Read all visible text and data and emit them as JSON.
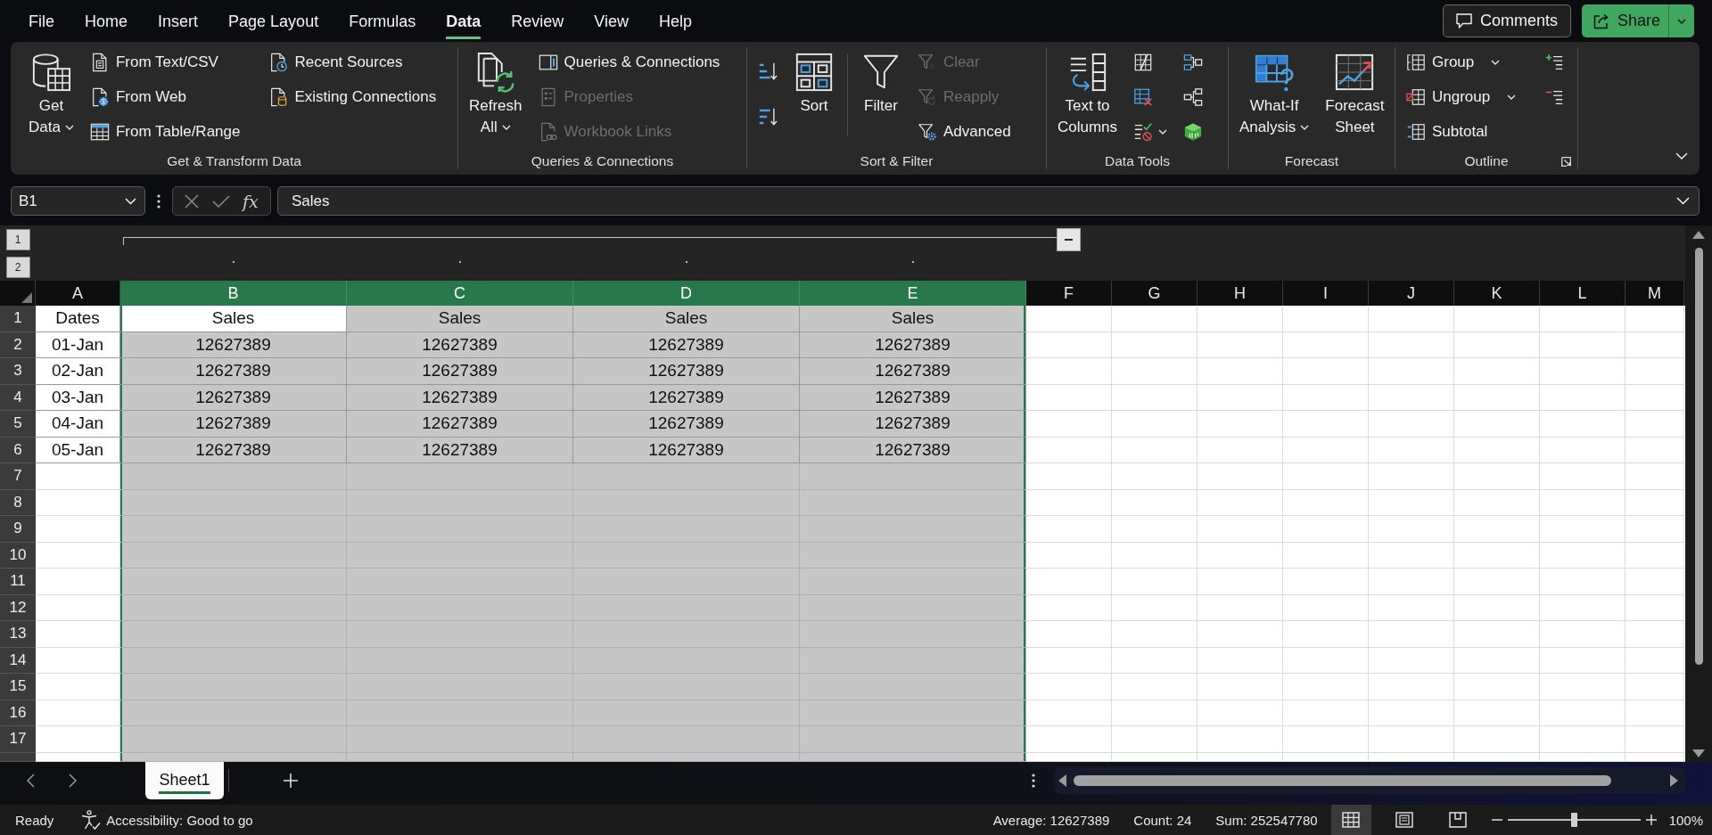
{
  "menu": {
    "tabs": [
      {
        "label": "File",
        "selected": false
      },
      {
        "label": "Home",
        "selected": false
      },
      {
        "label": "Insert",
        "selected": false
      },
      {
        "label": "Page Layout",
        "selected": false
      },
      {
        "label": "Formulas",
        "selected": false
      },
      {
        "label": "Data",
        "selected": true
      },
      {
        "label": "Review",
        "selected": false
      },
      {
        "label": "View",
        "selected": false
      },
      {
        "label": "Help",
        "selected": false
      }
    ]
  },
  "actions": {
    "comments": "Comments",
    "share": "Share"
  },
  "ribbon": {
    "groups": [
      {
        "label": "Get & Transform Data",
        "dialog_launcher": false,
        "controls": [
          {
            "kind": "large",
            "lines": [
              "Get",
              "Data"
            ],
            "dropdown": true
          },
          {
            "kind": "stack",
            "buttons": [
              {
                "label": "From Text/CSV",
                "disabled": false,
                "dropdown": false
              },
              {
                "label": "From Web",
                "disabled": false,
                "dropdown": false
              },
              {
                "label": "From Table/Range",
                "disabled": false,
                "dropdown": false
              }
            ]
          },
          {
            "kind": "stack",
            "buttons": [
              {
                "label": "Recent Sources",
                "disabled": false,
                "dropdown": false
              },
              {
                "label": "Existing Connections",
                "disabled": false,
                "dropdown": false
              }
            ]
          }
        ]
      },
      {
        "label": "Queries & Connections",
        "dialog_launcher": false,
        "controls": [
          {
            "kind": "large",
            "lines": [
              "Refresh",
              "All"
            ],
            "dropdown": true
          },
          {
            "kind": "stack",
            "buttons": [
              {
                "label": "Queries & Connections",
                "disabled": false,
                "dropdown": false
              },
              {
                "label": "Properties",
                "disabled": true,
                "dropdown": false
              },
              {
                "label": "Workbook Links",
                "disabled": true,
                "dropdown": false
              }
            ]
          }
        ]
      },
      {
        "label": "Sort & Filter",
        "dialog_launcher": false,
        "controls": [
          {
            "kind": "icons",
            "buttons": [
              {
                "disabled": false,
                "dropdown": false
              },
              {
                "disabled": false,
                "dropdown": false
              }
            ]
          },
          {
            "kind": "large",
            "lines": [
              "Sort"
            ],
            "dropdown": false
          },
          {
            "kind": "separator"
          },
          {
            "kind": "large",
            "lines": [
              "Filter"
            ],
            "dropdown": false
          },
          {
            "kind": "stack",
            "buttons": [
              {
                "label": "Clear",
                "disabled": true,
                "dropdown": false
              },
              {
                "label": "Reapply",
                "disabled": true,
                "dropdown": false
              },
              {
                "label": "Advanced",
                "disabled": false,
                "dropdown": false
              }
            ]
          }
        ]
      },
      {
        "label": "Data Tools",
        "dialog_launcher": false,
        "controls": [
          {
            "kind": "large",
            "lines": [
              "Text to",
              "Columns"
            ],
            "dropdown": false
          },
          {
            "kind": "icons",
            "buttons": [
              {
                "disabled": false,
                "dropdown": false
              },
              {
                "disabled": false,
                "dropdown": false
              },
              {
                "disabled": false,
                "dropdown": true
              }
            ]
          },
          {
            "kind": "icons",
            "buttons": [
              {
                "disabled": false,
                "dropdown": false
              },
              {
                "disabled": false,
                "dropdown": false
              },
              {
                "disabled": false,
                "dropdown": false
              }
            ]
          }
        ]
      },
      {
        "label": "Forecast",
        "dialog_launcher": false,
        "controls": [
          {
            "kind": "large",
            "lines": [
              "What-If",
              "Analysis"
            ],
            "dropdown": true
          },
          {
            "kind": "large",
            "lines": [
              "Forecast",
              "Sheet"
            ],
            "dropdown": false
          }
        ]
      },
      {
        "label": "Outline",
        "dialog_launcher": true,
        "controls": [
          {
            "kind": "stack",
            "buttons": [
              {
                "label": "Group",
                "disabled": false,
                "dropdown": true
              },
              {
                "label": "Ungroup",
                "disabled": false,
                "dropdown": true
              },
              {
                "label": "Subtotal",
                "disabled": false,
                "dropdown": false
              }
            ]
          },
          {
            "kind": "icons",
            "buttons": [
              {
                "disabled": false,
                "dropdown": false
              },
              {
                "disabled": false,
                "dropdown": false
              }
            ]
          }
        ]
      }
    ]
  },
  "formula_bar": {
    "name_box": "B1",
    "function_label": "fx",
    "formula": "Sales"
  },
  "outline": {
    "levels": [
      "1",
      "2"
    ]
  },
  "grid": {
    "columns": [
      {
        "label": "A",
        "selected": false,
        "grouped": false
      },
      {
        "label": "B",
        "selected": true,
        "grouped": true
      },
      {
        "label": "C",
        "selected": true,
        "grouped": true
      },
      {
        "label": "D",
        "selected": true,
        "grouped": true
      },
      {
        "label": "E",
        "selected": true,
        "grouped": true
      },
      {
        "label": "F",
        "selected": false,
        "grouped": false
      },
      {
        "label": "G",
        "selected": false,
        "grouped": false
      },
      {
        "label": "H",
        "selected": false,
        "grouped": false
      },
      {
        "label": "I",
        "selected": false,
        "grouped": false
      },
      {
        "label": "J",
        "selected": false,
        "grouped": false
      },
      {
        "label": "K",
        "selected": false,
        "grouped": false
      },
      {
        "label": "L",
        "selected": false,
        "grouped": false
      },
      {
        "label": "M",
        "selected": false,
        "grouped": false
      }
    ],
    "rows": [
      {
        "label": "1",
        "cells": [
          "Dates",
          "Sales",
          "Sales",
          "Sales",
          "Sales"
        ]
      },
      {
        "label": "2",
        "cells": [
          "01-Jan",
          "12627389",
          "12627389",
          "12627389",
          "12627389"
        ]
      },
      {
        "label": "3",
        "cells": [
          "02-Jan",
          "12627389",
          "12627389",
          "12627389",
          "12627389"
        ]
      },
      {
        "label": "4",
        "cells": [
          "03-Jan",
          "12627389",
          "12627389",
          "12627389",
          "12627389"
        ]
      },
      {
        "label": "5",
        "cells": [
          "04-Jan",
          "12627389",
          "12627389",
          "12627389",
          "12627389"
        ]
      },
      {
        "label": "6",
        "cells": [
          "05-Jan",
          "12627389",
          "12627389",
          "12627389",
          "12627389"
        ]
      },
      {
        "label": "7"
      },
      {
        "label": "8"
      },
      {
        "label": "9"
      },
      {
        "label": "10"
      },
      {
        "label": "11"
      },
      {
        "label": "12"
      },
      {
        "label": "13"
      },
      {
        "label": "14"
      },
      {
        "label": "15"
      },
      {
        "label": "16"
      },
      {
        "label": "17"
      }
    ]
  },
  "sheets": {
    "tabs": [
      {
        "label": "Sheet1",
        "selected": true
      }
    ]
  },
  "status_bar": {
    "mode": "Ready",
    "accessibility": "Accessibility: Good to go",
    "stats": [
      "Average: 12627389",
      "Count: 24",
      "Sum: 252547780"
    ],
    "views": [
      {
        "kind": "normal",
        "selected": true
      },
      {
        "kind": "page_layout",
        "selected": false
      },
      {
        "kind": "page_break",
        "selected": false
      }
    ],
    "zoom": {
      "level": 0.5,
      "label": "100%"
    }
  }
}
